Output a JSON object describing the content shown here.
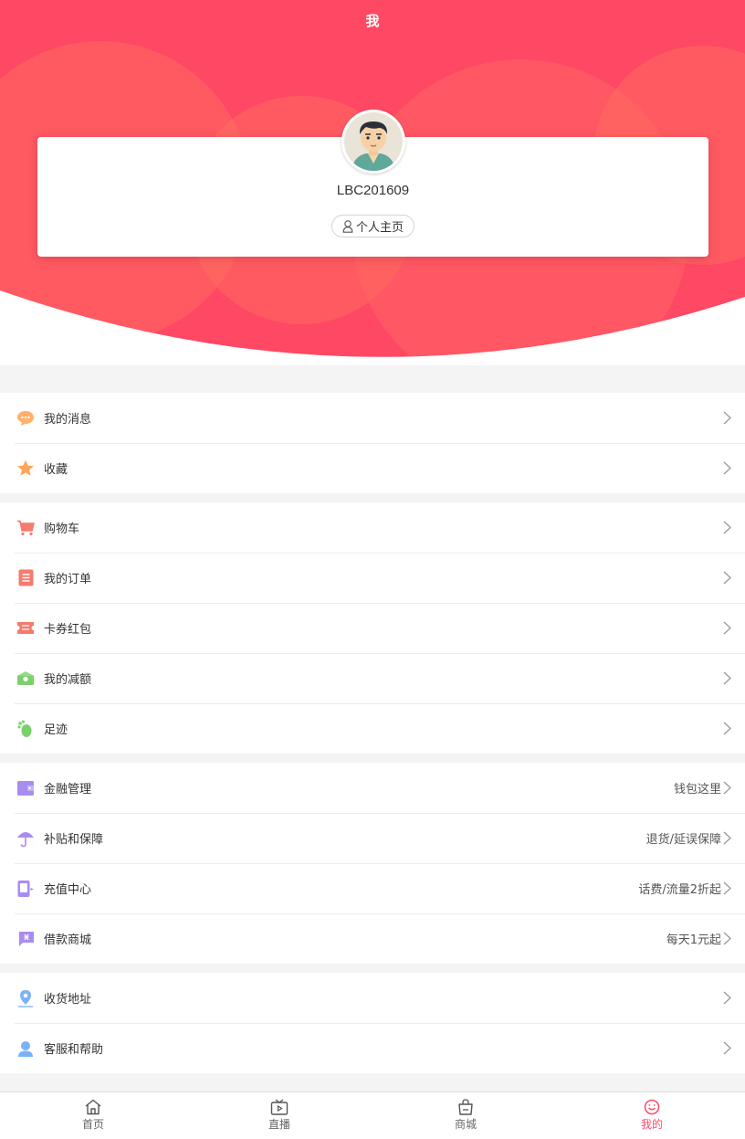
{
  "header": {
    "title": "我"
  },
  "profile": {
    "username": "LBC201609",
    "home_label": "个人主页"
  },
  "groups": [
    {
      "items": [
        {
          "label": "我的消息",
          "icon": "message-icon",
          "color": "#ffb06b"
        },
        {
          "label": "收藏",
          "icon": "star-icon",
          "color": "#ffa557"
        }
      ]
    },
    {
      "items": [
        {
          "label": "购物车",
          "icon": "cart-icon",
          "color": "#f57b6e"
        },
        {
          "label": "我的订单",
          "icon": "order-icon",
          "color": "#f57b6e"
        },
        {
          "label": "卡券红包",
          "icon": "coupon-icon",
          "color": "#f57b6e"
        },
        {
          "label": "我的减额",
          "icon": "discount-icon",
          "color": "#7ad16b"
        },
        {
          "label": "足迹",
          "icon": "footprint-icon",
          "color": "#7ad16b"
        }
      ]
    },
    {
      "items": [
        {
          "label": "金融管理",
          "extra": "钱包这里",
          "icon": "wallet-icon",
          "color": "#a98cf0"
        },
        {
          "label": "补贴和保障",
          "extra": "退货/延误保障",
          "icon": "umbrella-icon",
          "color": "#a98cf0"
        },
        {
          "label": "充值中心",
          "extra": "话费/流量2折起",
          "icon": "phone-icon",
          "color": "#a98cf0"
        },
        {
          "label": "借款商城",
          "extra": "每天1元起",
          "icon": "loan-icon",
          "color": "#a98cf0"
        }
      ]
    },
    {
      "items": [
        {
          "label": "收货地址",
          "icon": "location-icon",
          "color": "#7ab3f5"
        },
        {
          "label": "客服和帮助",
          "icon": "service-icon",
          "color": "#7ab3f5"
        }
      ]
    }
  ],
  "tabbar": {
    "items": [
      {
        "label": "首页",
        "icon": "home-icon"
      },
      {
        "label": "直播",
        "icon": "tv-icon"
      },
      {
        "label": "商城",
        "icon": "shop-bag-icon"
      },
      {
        "label": "我的",
        "icon": "smile-icon",
        "active": true
      }
    ]
  },
  "colors": {
    "accent": "#ff4a6a",
    "header_bg": "#ff4a63",
    "divider": "#ececec"
  }
}
